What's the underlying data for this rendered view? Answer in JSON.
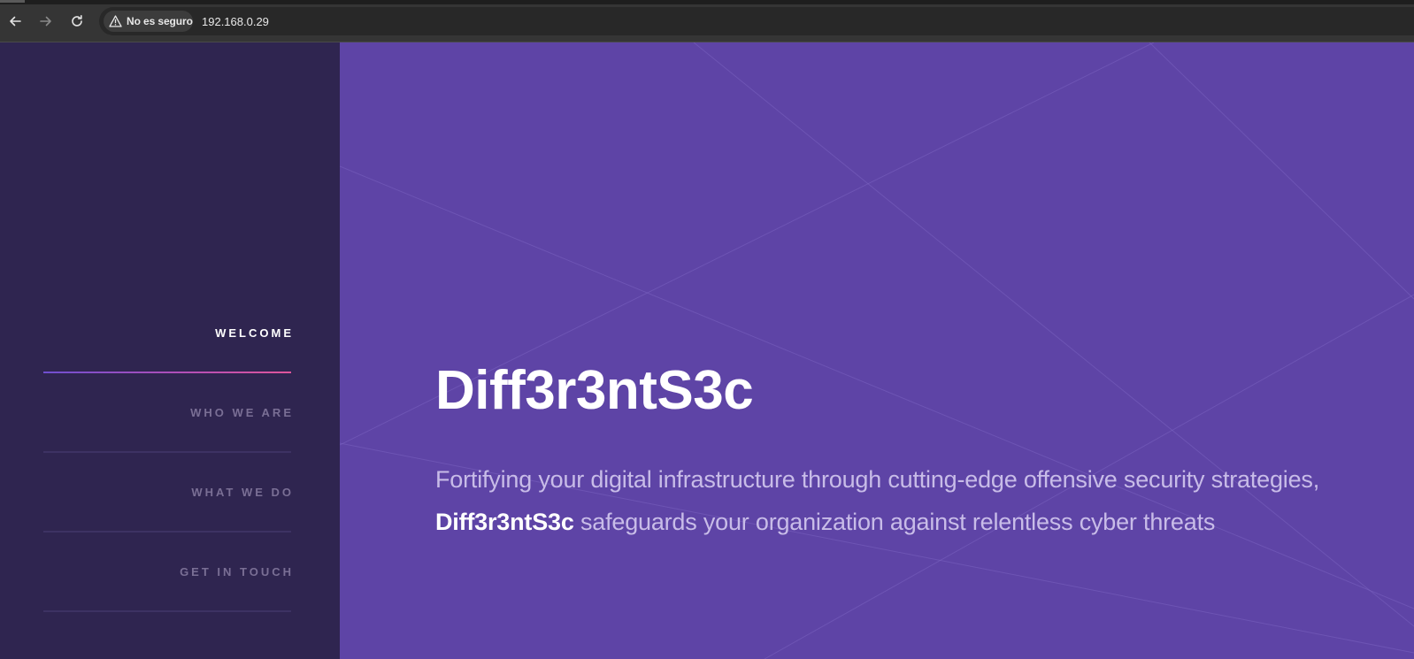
{
  "browser": {
    "nav": {
      "back_icon": "arrow-left-icon",
      "forward_icon": "arrow-right-icon",
      "reload_icon": "reload-icon"
    },
    "security_chip": {
      "icon": "warning-triangle-icon",
      "label": "No es seguro"
    },
    "url": "192.168.0.29"
  },
  "sidebar": {
    "items": [
      {
        "label": "WELCOME",
        "active": true
      },
      {
        "label": "WHO WE ARE",
        "active": false
      },
      {
        "label": "WHAT WE DO",
        "active": false
      },
      {
        "label": "GET IN TOUCH",
        "active": false
      }
    ]
  },
  "hero": {
    "title": "Diff3r3ntS3c",
    "text_line1": "Fortifying your digital infrastructure through cutting-edge offensive security strategies,",
    "text_brand": "Diff3r3ntS3c",
    "text_line2": " safeguards your organization against relentless cyber threats"
  },
  "colors": {
    "sidebar_bg": "#2f2550",
    "hero_bg": "#5e44a6",
    "active_underline_start": "#6f4fd0",
    "active_underline_end": "#e0559b",
    "inactive_label": "#7a6f95"
  }
}
